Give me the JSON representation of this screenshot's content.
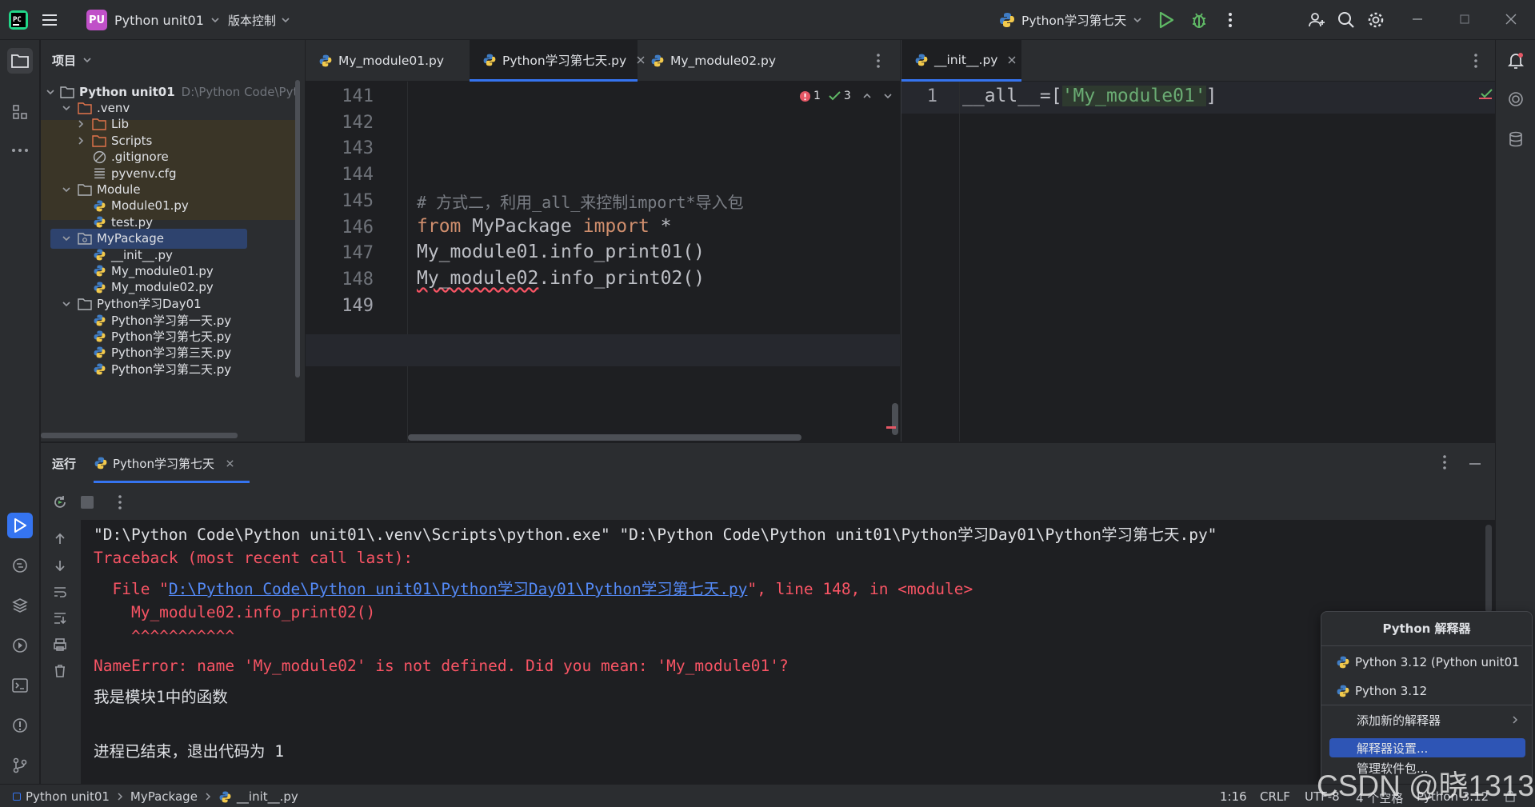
{
  "titlebar": {
    "project_badge": "PU",
    "project_name": "Python unit01",
    "vcs_menu": "版本控制",
    "run_config": "Python学习第七天"
  },
  "project_panel": {
    "title": "项目",
    "items": [
      {
        "label": "Python unit01",
        "path": "D:\\Python Code\\Pytho",
        "depth": 0,
        "kind": "folder",
        "expanded": true
      },
      {
        "label": ".venv",
        "depth": 1,
        "kind": "folder-excluded",
        "expanded": true
      },
      {
        "label": "Lib",
        "depth": 2,
        "kind": "folder-excluded",
        "expanded": false
      },
      {
        "label": "Scripts",
        "depth": 2,
        "kind": "folder-excluded",
        "expanded": false
      },
      {
        "label": ".gitignore",
        "depth": 2,
        "kind": "ignore-file"
      },
      {
        "label": "pyvenv.cfg",
        "depth": 2,
        "kind": "cfg-file"
      },
      {
        "label": "Module",
        "depth": 1,
        "kind": "folder",
        "expanded": true
      },
      {
        "label": "Module01.py",
        "depth": 2,
        "kind": "python-file"
      },
      {
        "label": "test.py",
        "depth": 2,
        "kind": "python-file"
      },
      {
        "label": "MyPackage",
        "depth": 1,
        "kind": "package",
        "expanded": true,
        "selected": true
      },
      {
        "label": "__init__.py",
        "depth": 2,
        "kind": "python-file"
      },
      {
        "label": "My_module01.py",
        "depth": 2,
        "kind": "python-file"
      },
      {
        "label": "My_module02.py",
        "depth": 2,
        "kind": "python-file"
      },
      {
        "label": "Python学习Day01",
        "depth": 1,
        "kind": "folder",
        "expanded": true
      },
      {
        "label": "Python学习第一天.py",
        "depth": 2,
        "kind": "python-file"
      },
      {
        "label": "Python学习第七天.py",
        "depth": 2,
        "kind": "python-file"
      },
      {
        "label": "Python学习第三天.py",
        "depth": 2,
        "kind": "python-file"
      },
      {
        "label": "Python学习第二天.py",
        "depth": 2,
        "kind": "python-file"
      }
    ]
  },
  "editor_left": {
    "tabs": [
      {
        "label": "My_module01.py",
        "active": false
      },
      {
        "label": "Python学习第七天.py",
        "active": true
      },
      {
        "label": "My_module02.py",
        "active": false
      }
    ],
    "inspections": {
      "errors": "1",
      "warnings": "3"
    },
    "lines": [
      {
        "num": "141",
        "text": ""
      },
      {
        "num": "142",
        "text": ""
      },
      {
        "num": "143",
        "text": ""
      },
      {
        "num": "144",
        "text": ""
      },
      {
        "num": "145",
        "comment": "# 方式二，利用_all_来控制import*导入包"
      },
      {
        "num": "146",
        "kw1": "from",
        "mid": " MyPackage ",
        "kw2": "import",
        "tail": " *"
      },
      {
        "num": "147",
        "text": "My_module01.info_print01()"
      },
      {
        "num": "148",
        "err": "My_module02",
        "rest": ".info_print02()"
      },
      {
        "num": "149",
        "text": ""
      }
    ]
  },
  "editor_right": {
    "tab": "__init__.py",
    "line_num": "1",
    "code_pre": "__all__=[",
    "code_str": "'My_module01'",
    "code_post": "]"
  },
  "run_panel": {
    "title": "运行",
    "tab": "Python学习第七天",
    "output": {
      "cmd": "\"D:\\Python Code\\Python unit01\\.venv\\Scripts\\python.exe\" \"D:\\Python Code\\Python unit01\\Python学习Day01\\Python学习第七天.py\"",
      "traceback": "Traceback (most recent call last):",
      "file_prefix": "  File \"",
      "file_link": "D:\\Python Code\\Python unit01\\Python学习Day01\\Python学习第七天.py",
      "file_suffix": "\", line 148, in <module>",
      "code_line": "    My_module02.info_print02()",
      "caret_line": "    ^^^^^^^^^^^",
      "error": "NameError: name 'My_module02' is not defined. Did you mean: 'My_module01'?",
      "stdout": "我是模块1中的函数",
      "exit": "进程已结束，退出代码为 1"
    }
  },
  "interpreter_popup": {
    "title": "Python 解释器",
    "items": [
      {
        "label": "Python 3.12 (Python unit01"
      },
      {
        "label": "Python 3.12"
      }
    ],
    "add": "添加新的解释器",
    "settings": "解释器设置...",
    "manage": "管理软件包..."
  },
  "statusbar": {
    "breadcrumb": [
      "Python unit01",
      "MyPackage",
      "__init__.py"
    ],
    "position": "1:16",
    "line_sep": "CRLF",
    "encoding": "UTF-8",
    "indent": "4 个空格",
    "interpreter": "Python 3.12"
  },
  "watermark": "CSDN @晓1313",
  "colors": {
    "accent": "#3574f0",
    "keyword": "#cf8e6d",
    "string": "#6aab73",
    "comment": "#7a7e85",
    "error": "#f75464",
    "link": "#548af7"
  }
}
